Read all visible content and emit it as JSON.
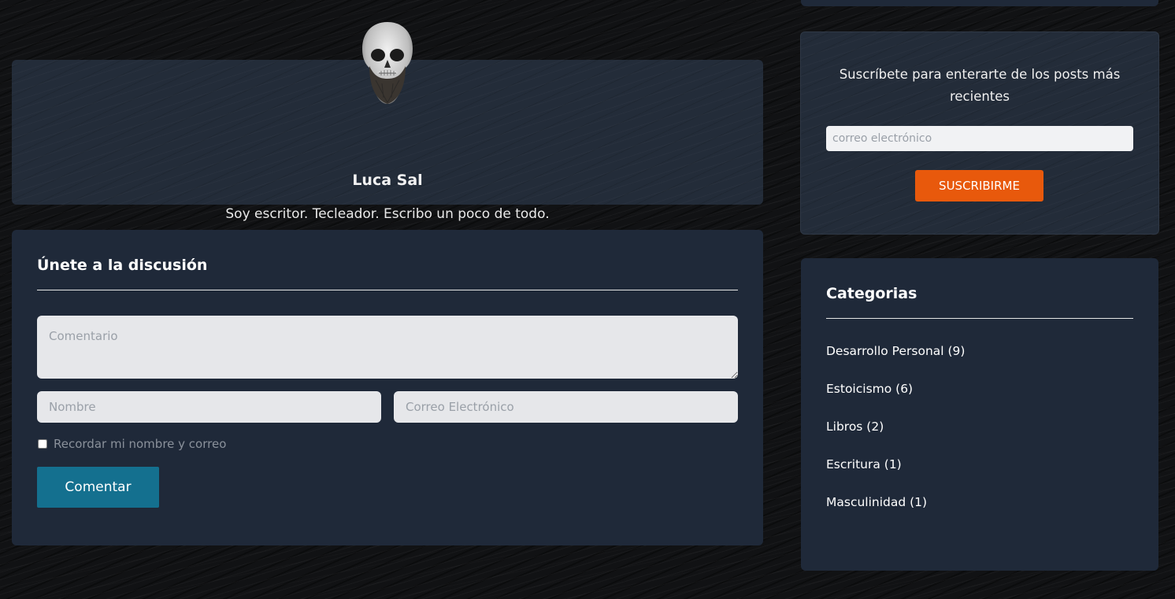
{
  "author": {
    "name": "Luca Sal",
    "bio": "Soy escritor. Tecleador. Escribo un poco de todo."
  },
  "discussion": {
    "title": "Únete a la discusión",
    "comment_placeholder": "Comentario",
    "name_placeholder": "Nombre",
    "email_placeholder": "Correo Electrónico",
    "remember_label": "Recordar mi nombre y correo",
    "remember_checked": false,
    "submit_label": "Comentar"
  },
  "subscribe": {
    "text": "Suscríbete para enterarte de los posts más recientes",
    "email_placeholder": "correo electrónico",
    "button_label": "SUSCRIBIRME"
  },
  "categories": {
    "title": "Categorias",
    "items": [
      {
        "label": "Desarrollo Personal (9)"
      },
      {
        "label": "Estoicismo (6)"
      },
      {
        "label": "Libros (2)"
      },
      {
        "label": "Escritura (1)"
      },
      {
        "label": "Masculinidad (1)"
      }
    ]
  },
  "colors": {
    "card_bg": "#1f2939",
    "comment_button": "#14708f",
    "subscribe_button": "#e8590c"
  },
  "icons": {
    "avatar": "skull-avatar-icon"
  }
}
